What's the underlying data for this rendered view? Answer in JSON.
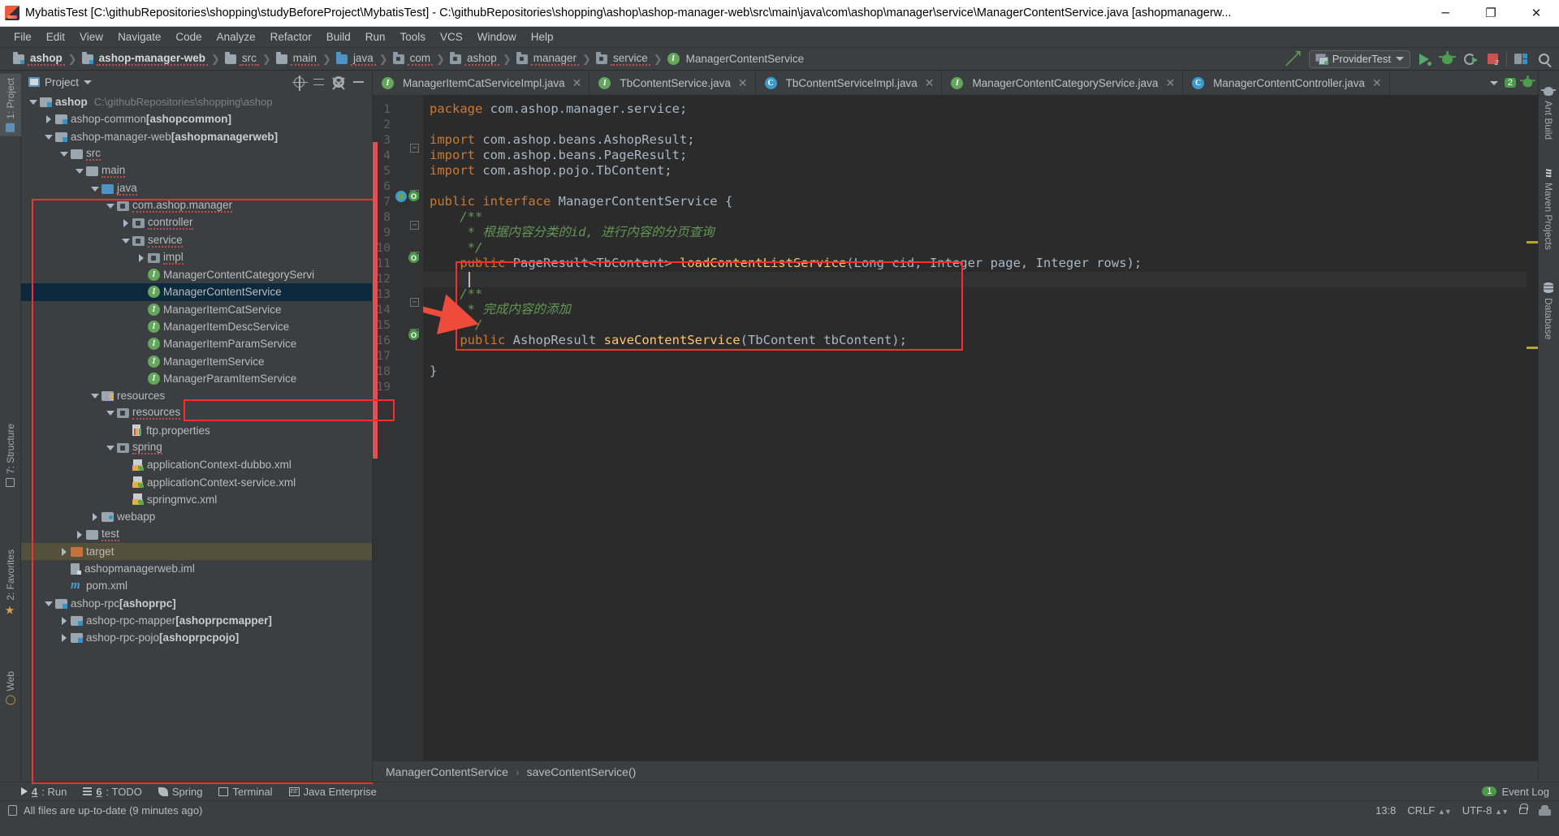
{
  "window": {
    "title": "MybatisTest [C:\\githubRepositories\\shopping\\studyBeforeProject\\MybatisTest] - C:\\githubRepositories\\shopping\\ashop\\ashop-manager-web\\src\\main\\java\\com\\ashop\\manager\\service\\ManagerContentService.java [ashopmanagerw...",
    "minimize": "─",
    "maximize": "❐",
    "close": "✕"
  },
  "menubar": {
    "items": [
      "File",
      "Edit",
      "View",
      "Navigate",
      "Code",
      "Analyze",
      "Refactor",
      "Build",
      "Run",
      "Tools",
      "VCS",
      "Window",
      "Help"
    ]
  },
  "navbar": {
    "crumbs": [
      {
        "label": "ashop",
        "icon": "module-icon",
        "bold": true
      },
      {
        "label": "ashop-manager-web",
        "icon": "module-icon",
        "bold": true
      },
      {
        "label": "src",
        "icon": "folder-icon",
        "bold": false
      },
      {
        "label": "main",
        "icon": "folder-icon",
        "bold": false
      },
      {
        "label": "java",
        "icon": "source-folder-icon",
        "bold": false
      },
      {
        "label": "com",
        "icon": "package-icon",
        "bold": false
      },
      {
        "label": "ashop",
        "icon": "package-icon",
        "bold": false
      },
      {
        "label": "manager",
        "icon": "package-icon",
        "bold": false
      },
      {
        "label": "service",
        "icon": "package-icon",
        "bold": false
      },
      {
        "label": "ManagerContentService",
        "icon": "interface-icon",
        "bold": false
      }
    ],
    "run_configuration": "ProviderTest",
    "toolbar_icons": [
      "update-project-icon",
      "run-icon",
      "debug-icon",
      "run-with-coverage-icon",
      "stop-icon",
      "project-structure-icon",
      "search-everywhere-icon"
    ]
  },
  "left_strip": {
    "tabs": [
      {
        "label": "1: Project",
        "icon": "project-icon",
        "active": true
      },
      {
        "label": "7: Structure",
        "icon": "structure-icon",
        "active": false
      },
      {
        "label": "2: Favorites",
        "icon": "favorites-icon",
        "active": false
      },
      {
        "label": "Web",
        "icon": "web-icon",
        "active": false
      }
    ]
  },
  "right_strip": {
    "tabs": [
      {
        "label": "Ant Build",
        "icon": "ant-icon"
      },
      {
        "label": "Maven Projects",
        "icon": "maven-icon"
      },
      {
        "label": "Database",
        "icon": "database-icon"
      }
    ]
  },
  "project_panel": {
    "title": "Project",
    "header_icons": [
      "locate-icon",
      "collapse-all-icon",
      "gear-icon",
      "hide-icon"
    ],
    "tree": [
      {
        "depth": 0,
        "twist": "down",
        "icon": "module-icon",
        "label": "ashop",
        "bold": true,
        "path": "C:\\githubRepositories\\shopping\\ashop"
      },
      {
        "depth": 1,
        "twist": "right",
        "icon": "module-icon",
        "label": "ashop-common ",
        "suffix": "[ashopcommon]"
      },
      {
        "depth": 1,
        "twist": "down",
        "icon": "module-icon",
        "label": "ashop-manager-web ",
        "suffix": "[ashopmanagerweb]"
      },
      {
        "depth": 2,
        "twist": "down",
        "icon": "folder-icon",
        "label": "src"
      },
      {
        "depth": 3,
        "twist": "down",
        "icon": "folder-icon",
        "label": "main"
      },
      {
        "depth": 4,
        "twist": "down",
        "icon": "source-folder-icon",
        "label": "java"
      },
      {
        "depth": 5,
        "twist": "down",
        "icon": "package-icon",
        "label": "com.ashop.manager"
      },
      {
        "depth": 6,
        "twist": "right",
        "icon": "package-icon",
        "label": "controller"
      },
      {
        "depth": 6,
        "twist": "down",
        "icon": "package-icon",
        "label": "service"
      },
      {
        "depth": 7,
        "twist": "right",
        "icon": "package-icon",
        "label": "impl"
      },
      {
        "depth": 7,
        "twist": "none",
        "icon": "interface-icon",
        "label": "ManagerContentCategoryServi"
      },
      {
        "depth": 7,
        "twist": "none",
        "icon": "interface-icon",
        "label": "ManagerContentService",
        "selected": true
      },
      {
        "depth": 7,
        "twist": "none",
        "icon": "interface-icon",
        "label": "ManagerItemCatService"
      },
      {
        "depth": 7,
        "twist": "none",
        "icon": "interface-icon",
        "label": "ManagerItemDescService"
      },
      {
        "depth": 7,
        "twist": "none",
        "icon": "interface-icon",
        "label": "ManagerItemParamService"
      },
      {
        "depth": 7,
        "twist": "none",
        "icon": "interface-icon",
        "label": "ManagerItemService"
      },
      {
        "depth": 7,
        "twist": "none",
        "icon": "interface-icon",
        "label": "ManagerParamItemService"
      },
      {
        "depth": 4,
        "twist": "down",
        "icon": "resource-folder-icon",
        "label": "resources"
      },
      {
        "depth": 5,
        "twist": "down",
        "icon": "package-icon",
        "label": "resources"
      },
      {
        "depth": 6,
        "twist": "none",
        "icon": "properties-icon",
        "label": "ftp.properties"
      },
      {
        "depth": 5,
        "twist": "down",
        "icon": "package-icon",
        "label": "spring"
      },
      {
        "depth": 6,
        "twist": "none",
        "icon": "spring-xml-icon",
        "label": "applicationContext-dubbo.xml"
      },
      {
        "depth": 6,
        "twist": "none",
        "icon": "spring-xml-icon",
        "label": "applicationContext-service.xml"
      },
      {
        "depth": 6,
        "twist": "none",
        "icon": "spring-xml-icon",
        "label": "springmvc.xml"
      },
      {
        "depth": 4,
        "twist": "right",
        "icon": "webapp-folder-icon",
        "label": "webapp"
      },
      {
        "depth": 3,
        "twist": "right",
        "icon": "folder-icon",
        "label": "test"
      },
      {
        "depth": 2,
        "twist": "right",
        "icon": "target-folder-icon",
        "label": "target",
        "target": true
      },
      {
        "depth": 2,
        "twist": "none",
        "icon": "iml-icon",
        "label": "ashopmanagerweb.iml"
      },
      {
        "depth": 2,
        "twist": "none",
        "icon": "maven-pom-icon",
        "label": "pom.xml"
      },
      {
        "depth": 1,
        "twist": "down",
        "icon": "module-icon",
        "label": "ashop-rpc ",
        "suffix": "[ashoprpc]"
      },
      {
        "depth": 2,
        "twist": "right",
        "icon": "module-icon",
        "label": "ashop-rpc-mapper ",
        "suffix": "[ashoprpcmapper]"
      },
      {
        "depth": 2,
        "twist": "right",
        "icon": "module-icon",
        "label": "ashop-rpc-pojo ",
        "suffix": "[ashoprpcpojo]"
      }
    ]
  },
  "editor": {
    "tabs": [
      {
        "label": "ManagerItemCatServiceImpl.java",
        "icon": "interface-icon",
        "active": false
      },
      {
        "label": "TbContentService.java",
        "icon": "interface-icon",
        "active": false
      },
      {
        "label": "TbContentServiceImpl.java",
        "icon": "class-icon",
        "active": false
      },
      {
        "label": "ManagerContentCategoryService.java",
        "icon": "interface-icon",
        "active": false
      },
      {
        "label": "ManagerContentController.java",
        "icon": "class-icon",
        "active": false
      }
    ],
    "tab_badge": "2",
    "line_numbers": [
      1,
      2,
      3,
      4,
      5,
      6,
      7,
      8,
      9,
      10,
      11,
      12,
      13,
      14,
      15,
      16,
      17,
      18,
      19
    ],
    "code_lines": [
      {
        "n": 1,
        "segs": [
          {
            "t": "package",
            "c": "kw"
          },
          {
            "t": " com.ashop.manager.service;",
            "c": "pl"
          }
        ]
      },
      {
        "n": 2,
        "segs": []
      },
      {
        "n": 3,
        "segs": [
          {
            "t": "import",
            "c": "kw"
          },
          {
            "t": " com.ashop.beans.AshopResult;",
            "c": "pl"
          }
        ]
      },
      {
        "n": 4,
        "segs": [
          {
            "t": "import",
            "c": "kw"
          },
          {
            "t": " com.ashop.beans.PageResult;",
            "c": "pl"
          }
        ]
      },
      {
        "n": 5,
        "segs": [
          {
            "t": "import",
            "c": "kw"
          },
          {
            "t": " com.ashop.pojo.TbContent;",
            "c": "pl"
          }
        ]
      },
      {
        "n": 6,
        "segs": []
      },
      {
        "n": 7,
        "segs": [
          {
            "t": "public interface",
            "c": "kw"
          },
          {
            "t": " ManagerContentService {",
            "c": "pl"
          }
        ]
      },
      {
        "n": 8,
        "segs": [
          {
            "t": "    /**",
            "c": "cmt"
          }
        ]
      },
      {
        "n": 9,
        "segs": [
          {
            "t": "     * 根据内容分类的id, 进行内容的分页查询",
            "c": "cmt"
          }
        ]
      },
      {
        "n": 10,
        "segs": [
          {
            "t": "     */",
            "c": "cmt"
          }
        ]
      },
      {
        "n": 11,
        "segs": [
          {
            "t": "    public",
            "c": "kw"
          },
          {
            "t": " PageResult<TbContent> ",
            "c": "pl"
          },
          {
            "t": "loadContentListService",
            "c": "mth"
          },
          {
            "t": "(Long cid, Integer page, Integer rows);",
            "c": "pl"
          }
        ]
      },
      {
        "n": 12,
        "segs": []
      },
      {
        "n": 13,
        "segs": [
          {
            "t": "    /**",
            "c": "cmt"
          }
        ]
      },
      {
        "n": 14,
        "segs": [
          {
            "t": "     * 完成内容的添加",
            "c": "cmt"
          }
        ]
      },
      {
        "n": 15,
        "segs": [
          {
            "t": "     */",
            "c": "cmt"
          }
        ]
      },
      {
        "n": 16,
        "segs": [
          {
            "t": "    public",
            "c": "kw"
          },
          {
            "t": " AshopResult ",
            "c": "pl"
          },
          {
            "t": "saveContentService",
            "c": "mth"
          },
          {
            "t": "(TbContent tbContent);",
            "c": "pl"
          }
        ]
      },
      {
        "n": 17,
        "segs": []
      },
      {
        "n": 18,
        "segs": [
          {
            "t": "}",
            "c": "pl"
          }
        ]
      },
      {
        "n": 19,
        "segs": []
      }
    ],
    "breadcrumb": [
      "ManagerContentService",
      "saveContentService()"
    ],
    "breadcrumb_separator": "›"
  },
  "bottom": {
    "tool_windows": [
      {
        "num": "4",
        "label": ": Run",
        "icon": "run-icon"
      },
      {
        "num": "6",
        "label": ": TODO",
        "icon": "todo-icon"
      },
      {
        "num": "",
        "label": "Spring",
        "icon": "spring-icon"
      },
      {
        "num": "",
        "label": "Terminal",
        "icon": "terminal-icon"
      },
      {
        "num": "",
        "label": "Java Enterprise",
        "icon": "java-enterprise-icon"
      }
    ],
    "event_log": {
      "count": "1",
      "label": "Event Log"
    },
    "status_message": "All files are up-to-date (9 minutes ago)",
    "caret_position": "13:8",
    "line_separator": "CRLF",
    "encoding": "UTF-8",
    "lock_icon": "unlocked-icon",
    "inspector_icon": "inspection-hector-icon"
  },
  "colors": {
    "accent": "#4a88c7",
    "annotation_red": "#ff2d2d",
    "green_interface": "#64a65b",
    "blue_class": "#3d9ac9",
    "keyword_orange": "#cc7832",
    "comment_green": "#629755",
    "method_yellow": "#ffc66d",
    "panel_bg": "#3c3f41",
    "editor_bg": "#2b2b2b"
  }
}
